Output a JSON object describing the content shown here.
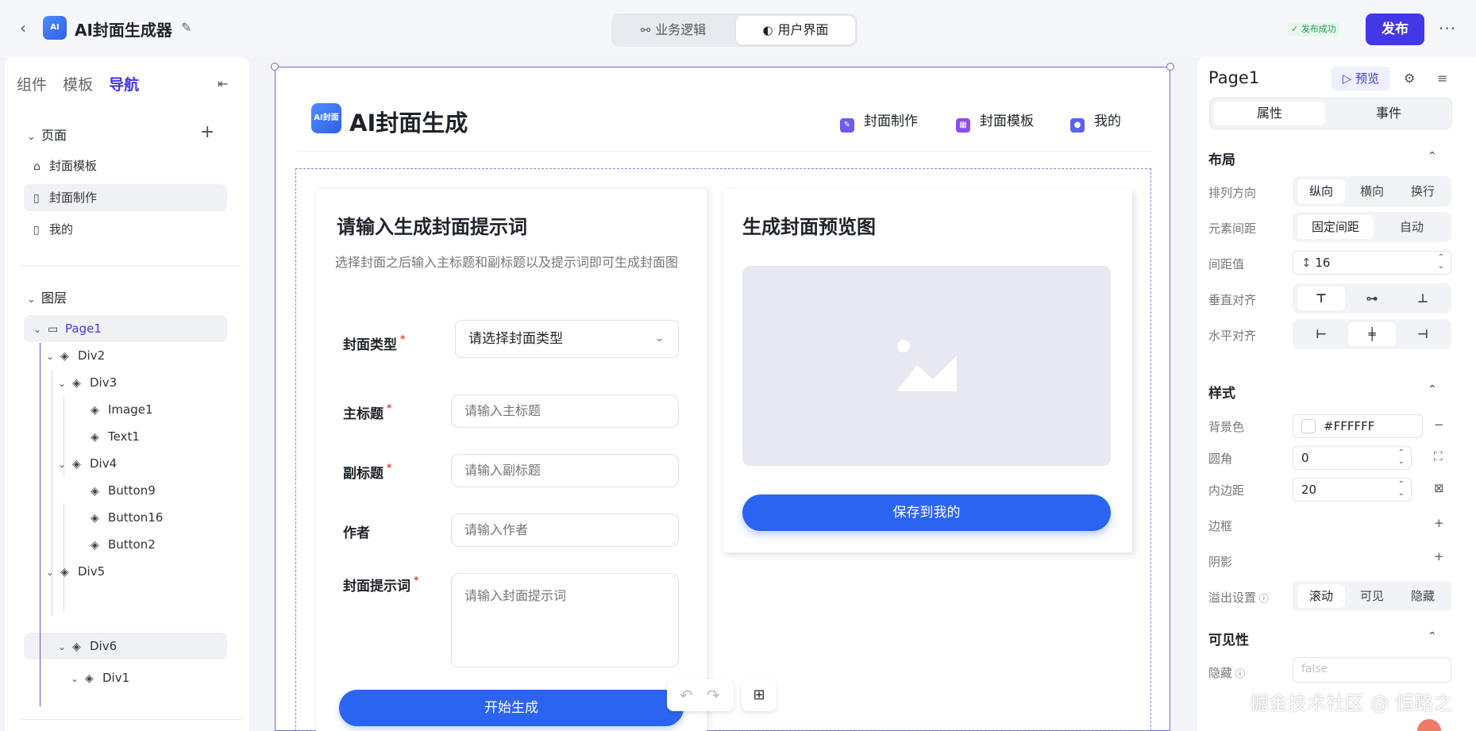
{
  "topbar": {
    "back_icon": "chevron-left-icon",
    "app_title": "AI封面生成器",
    "edit_icon": "edit-icon",
    "modes": [
      "业务逻辑",
      "用户界面"
    ],
    "active_mode": "用户界面",
    "publish_status": "✓ 发布成功",
    "publish_label": "发布",
    "more_icon": "more-icon"
  },
  "left_panel": {
    "tabs": [
      "组件",
      "模板",
      "导航"
    ],
    "active_tab": "导航",
    "pages_section": "页面",
    "pages": [
      "封面模板",
      "封面制作",
      "我的"
    ],
    "selected_page": "封面制作",
    "layers_section": "图层",
    "layers": [
      {
        "label": "Page1",
        "depth": 0
      },
      {
        "label": "Div2",
        "depth": 1
      },
      {
        "label": "Div3",
        "depth": 2
      },
      {
        "label": "Image1",
        "depth": 3
      },
      {
        "label": "Text1",
        "depth": 3
      },
      {
        "label": "Div4",
        "depth": 2
      },
      {
        "label": "Button9",
        "depth": 3
      },
      {
        "label": "Button16",
        "depth": 3
      },
      {
        "label": "Button2",
        "depth": 3
      },
      {
        "label": "Div5",
        "depth": 1
      },
      {
        "label": "Div6",
        "depth": 2
      },
      {
        "label": "Div1",
        "depth": 3
      }
    ]
  },
  "canvas": {
    "logo_text": "AI封面",
    "site_title": "AI封面生成",
    "nav": [
      "封面制作",
      "封面模板",
      "我的"
    ],
    "nav_colors": [
      "#6b5cf0",
      "#8a4ff0",
      "#5a62f5"
    ],
    "form": {
      "title": "请输入生成封面提示词",
      "description": "选择封面之后输入主标题和副标题以及提示词即可生成封面图",
      "type_label": "封面类型",
      "type_placeholder": "请选择封面类型",
      "main_title_label": "主标题",
      "main_title_placeholder": "请输入主标题",
      "subtitle_label": "副标题",
      "subtitle_placeholder": "请输入副标题",
      "author_label": "作者",
      "author_placeholder": "请输入作者",
      "prompt_label": "封面提示词",
      "prompt_placeholder": "请输入封面提示词",
      "generate_label": "开始生成"
    },
    "preview": {
      "title": "生成封面预览图",
      "image_icon": "image-placeholder-icon",
      "save_label": "保存到我的"
    }
  },
  "right_panel": {
    "title": "Page1",
    "preview_label": "预览",
    "tabs": [
      "属性",
      "事件"
    ],
    "active_tab": "属性",
    "layout": {
      "title": "布局",
      "direction_label": "排列方向",
      "direction_options": [
        "纵向",
        "横向",
        "换行"
      ],
      "direction_value": "纵向",
      "spacing_label": "元素间距",
      "spacing_options": [
        "固定间距",
        "自动"
      ],
      "spacing_value": "固定间距",
      "gap_label": "间距值",
      "gap_value": "16",
      "valign_label": "垂直对齐",
      "halign_label": "水平对齐"
    },
    "style": {
      "title": "样式",
      "bg_label": "背景色",
      "bg_value": "#FFFFFF",
      "radius_label": "圆角",
      "radius_value": "0",
      "padding_label": "内边距",
      "padding_value": "20",
      "border_label": "边框",
      "shadow_label": "阴影",
      "overflow_label": "溢出设置",
      "overflow_options": [
        "滚动",
        "可见",
        "隐藏"
      ],
      "overflow_value": "滚动"
    },
    "visibility": {
      "title": "可见性",
      "hidden_label": "隐藏",
      "hidden_value": "false"
    }
  },
  "watermark": "掘金技术社区 @ 恒路之",
  "colors": {
    "accent": "#4338e8",
    "primary_button": "#2b64f0",
    "success": "#22a05a"
  }
}
